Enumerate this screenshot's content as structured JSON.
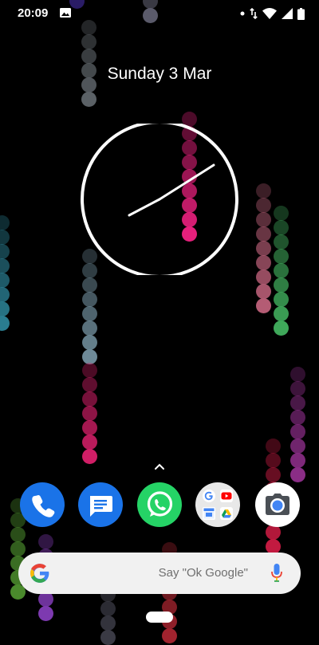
{
  "status_bar": {
    "time": "20:09",
    "icons": [
      "gallery-icon",
      "dot-icon",
      "data-transfer-icon",
      "wifi-icon",
      "signal-icon",
      "battery-icon"
    ]
  },
  "home": {
    "date_label": "Sunday 3 Mar",
    "clock": {
      "hour": 20,
      "minute": 9
    }
  },
  "dock": {
    "apps": [
      {
        "name": "Phone",
        "icon": "phone-icon",
        "color": "#1a73e8"
      },
      {
        "name": "Messages",
        "icon": "messages-icon",
        "color": "#1a73e8"
      },
      {
        "name": "WhatsApp",
        "icon": "whatsapp-icon",
        "color": "#25d366"
      },
      {
        "name": "Google folder",
        "icon": "google-apps-folder-icon",
        "color": "#e8e8e8"
      },
      {
        "name": "Camera",
        "icon": "camera-icon",
        "color": "#ffffff"
      }
    ]
  },
  "search_bar": {
    "placeholder": "Say \"Ok Google\"",
    "logo": "google-g-icon",
    "mic": "mic-icon"
  },
  "colors": {
    "background": "#000000",
    "search_bar": "#f1f1f1",
    "accent_pink": "#e91e78"
  }
}
